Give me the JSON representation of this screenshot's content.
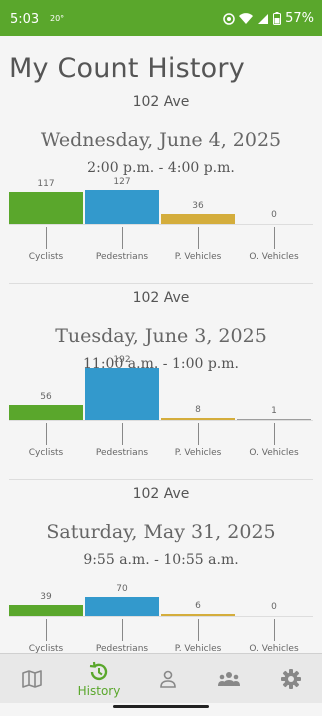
{
  "status_bar": {
    "time": "5:03",
    "temperature": "20°",
    "battery": "57%",
    "icons": [
      "do-not-disturb-icon",
      "wifi-icon",
      "signal-icon",
      "battery-icon"
    ]
  },
  "page_title": "My Count History",
  "categories": [
    "Cyclists",
    "Pedestrians",
    "P. Vehicles",
    "O. Vehicles"
  ],
  "colors": {
    "accent": "#5aa72c",
    "cyclists": "#5aa72c",
    "pedestrians": "#3399cc",
    "p_vehicles": "#d4ad3c",
    "o_vehicles": "#9e9e9e"
  },
  "entries": [
    {
      "location": "102 Ave",
      "date": "Wednesday, June 4, 2025",
      "time_range": "2:00 p.m. - 4:00 p.m.",
      "chart_data": {
        "type": "bar",
        "categories": [
          "Cyclists",
          "Pedestrians",
          "P. Vehicles",
          "O. Vehicles"
        ],
        "values": [
          117,
          127,
          36,
          0
        ]
      }
    },
    {
      "location": "102 Ave",
      "date": "Tuesday, June 3, 2025",
      "time_range": "11:00 a.m. - 1:00 p.m.",
      "chart_data": {
        "type": "bar",
        "categories": [
          "Cyclists",
          "Pedestrians",
          "P. Vehicles",
          "O. Vehicles"
        ],
        "values": [
          56,
          192,
          8,
          1
        ]
      }
    },
    {
      "location": "102 Ave",
      "date": "Saturday, May 31, 2025",
      "time_range": "9:55 a.m. - 10:55 a.m.",
      "chart_data": {
        "type": "bar",
        "categories": [
          "Cyclists",
          "Pedestrians",
          "P. Vehicles",
          "O. Vehicles"
        ],
        "values": [
          39,
          70,
          6,
          0
        ]
      }
    }
  ],
  "bottom_nav": {
    "items": [
      {
        "icon": "map-icon",
        "label": ""
      },
      {
        "icon": "history-icon",
        "label": "History",
        "active": true
      },
      {
        "icon": "person-icon",
        "label": ""
      },
      {
        "icon": "group-icon",
        "label": ""
      },
      {
        "icon": "gear-icon",
        "label": ""
      }
    ]
  }
}
